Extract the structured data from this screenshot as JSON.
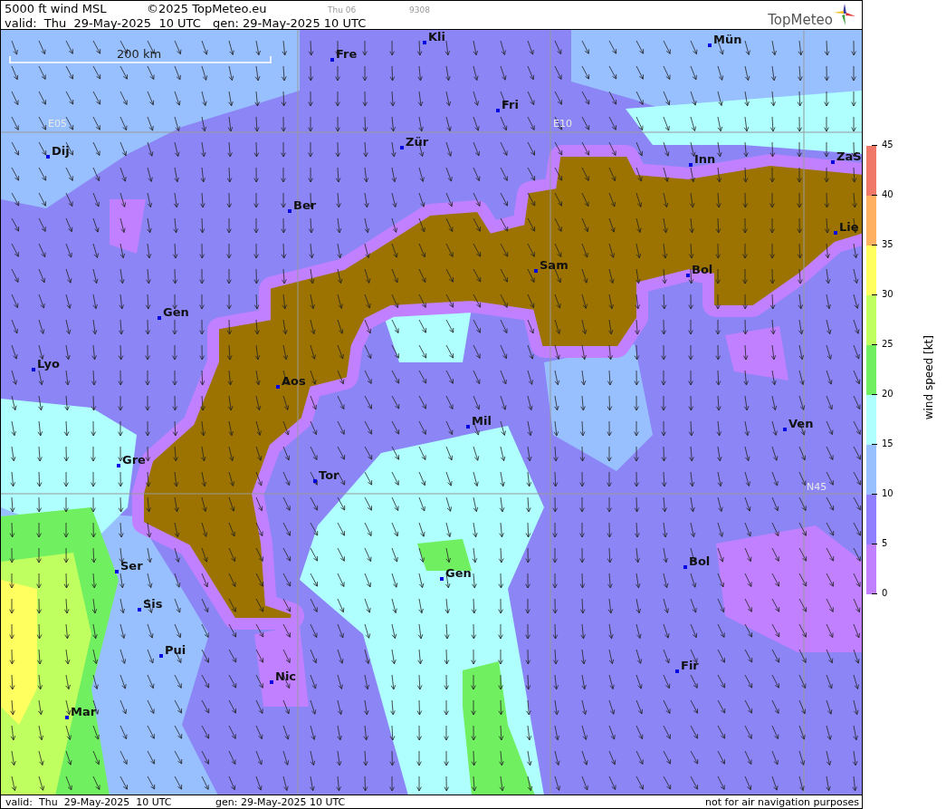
{
  "header": {
    "line_1": [
      {
        "text": "5000 ft wind MSL",
        "kind": "title"
      },
      {
        "text": "©2025 TopMeteo.eu",
        "kind": "title"
      },
      {
        "text": "Thu 06",
        "kind": "minor"
      },
      {
        "text": "9308",
        "kind": "minor"
      }
    ],
    "line_2": [
      "valid:  Thu  29-May-2025  10 UTC",
      "gen: 29-May-2025 10 UTC"
    ],
    "logo": "TopMeteo"
  },
  "map": {
    "scale_label": "200 km",
    "grid_labels": [
      "E05",
      "E10",
      "N45"
    ],
    "cities": [
      {
        "name": "Kli"
      },
      {
        "name": "Mün"
      },
      {
        "name": "Fre"
      },
      {
        "name": "Fri"
      },
      {
        "name": "Dij"
      },
      {
        "name": "Zür"
      },
      {
        "name": "Inn"
      },
      {
        "name": "ZaS"
      },
      {
        "name": "Ber"
      },
      {
        "name": "Lie"
      },
      {
        "name": "Sam"
      },
      {
        "name": "Bol"
      },
      {
        "name": "Gen"
      },
      {
        "name": "Lyo"
      },
      {
        "name": "Aos"
      },
      {
        "name": "Mil"
      },
      {
        "name": "Ven"
      },
      {
        "name": "Gre"
      },
      {
        "name": "Tor"
      },
      {
        "name": "Ser"
      },
      {
        "name": "Gen"
      },
      {
        "name": "Bol"
      },
      {
        "name": "Sis"
      },
      {
        "name": "Pui"
      },
      {
        "name": "Nic"
      },
      {
        "name": "Fir"
      },
      {
        "name": "Mar"
      }
    ]
  },
  "footer": {
    "valid": "valid:  Thu  29-May-2025  10 UTC",
    "gen": "gen: 29-May-2025 10 UTC",
    "note": "not for air navigation purposes"
  },
  "legend": {
    "title": "wind speed [kt]",
    "ticks": [
      "45",
      "40",
      "35",
      "30",
      "25",
      "20",
      "15",
      "10",
      "5",
      "0"
    ],
    "bands": [
      {
        "color": "#f07868"
      },
      {
        "color": "#ffb060"
      },
      {
        "color": "#ffff60"
      },
      {
        "color": "#c0ff60"
      },
      {
        "color": "#70f060"
      },
      {
        "color": "#b0ffff"
      },
      {
        "color": "#98c0ff"
      },
      {
        "color": "#9080ff"
      },
      {
        "color": "#c080ff"
      }
    ]
  }
}
